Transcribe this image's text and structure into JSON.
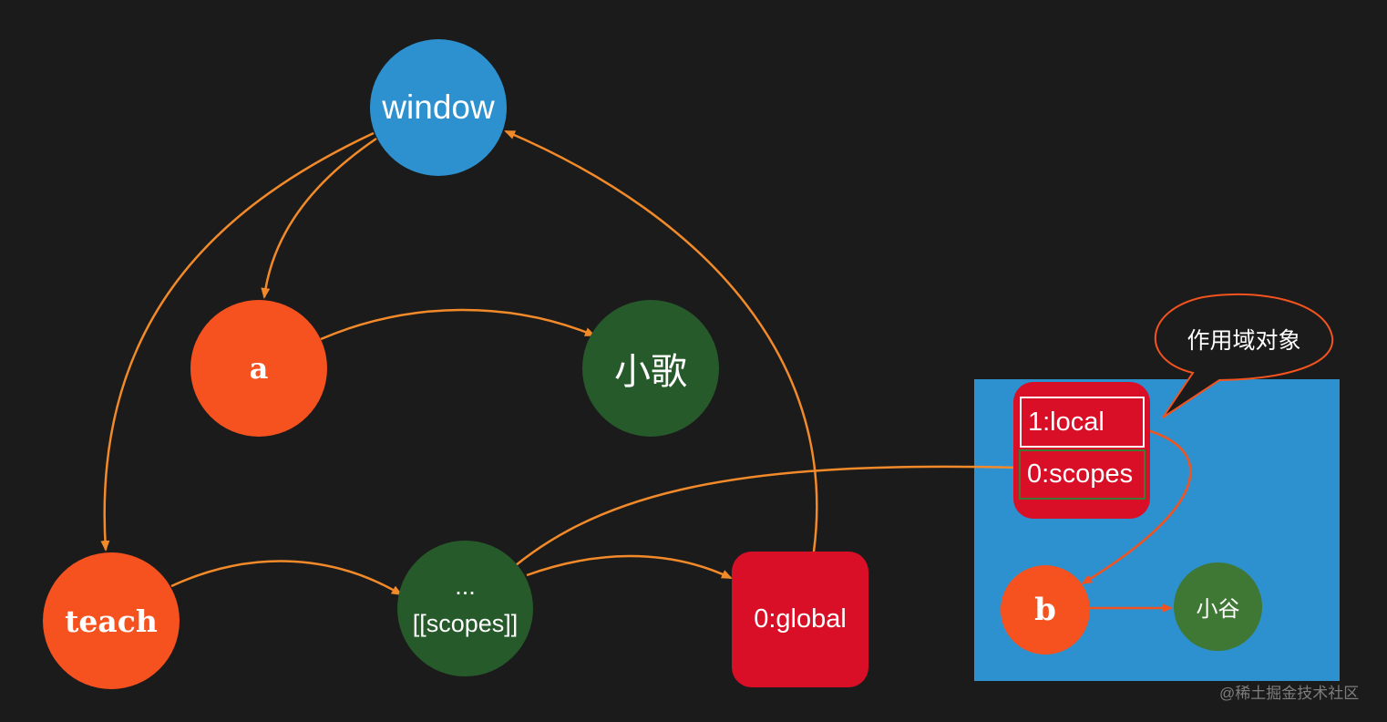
{
  "colors": {
    "background": "#1b1b1b",
    "arrow_orange": "#f28a2a",
    "arrow_red_orange": "#f2531f",
    "node_orange": "#f5521f",
    "node_dark_green": "#275a2b",
    "node_green": "#3f7834",
    "node_blue": "#2d91cf",
    "node_red": "#d90f28"
  },
  "nodes": {
    "window": {
      "label": "window"
    },
    "a": {
      "label": "a"
    },
    "xiaoge": {
      "label": "小歌"
    },
    "teach": {
      "label": "teach"
    },
    "scopes_obj": {
      "dots": "...",
      "label": "[[scopes]]"
    },
    "global": {
      "label": "0:global"
    },
    "b": {
      "label": "b"
    },
    "xiaogu": {
      "label": "小谷"
    }
  },
  "scope_object": {
    "slots": [
      {
        "label": "1:local"
      },
      {
        "label": "0:scopes"
      }
    ],
    "callout": "作用域对象"
  },
  "edges": [
    {
      "from": "window",
      "to": "a"
    },
    {
      "from": "window",
      "to": "teach"
    },
    {
      "from": "a",
      "to": "xiaoge"
    },
    {
      "from": "teach",
      "to": "scopes_obj"
    },
    {
      "from": "scopes_obj",
      "to": "global"
    },
    {
      "from": "global",
      "to": "window"
    },
    {
      "from": "scope_slot_0",
      "to": "scopes_obj"
    },
    {
      "from": "scope_slot_1",
      "to": "b"
    },
    {
      "from": "b",
      "to": "xiaogu"
    }
  ],
  "watermark": "@稀土掘金技术社区"
}
